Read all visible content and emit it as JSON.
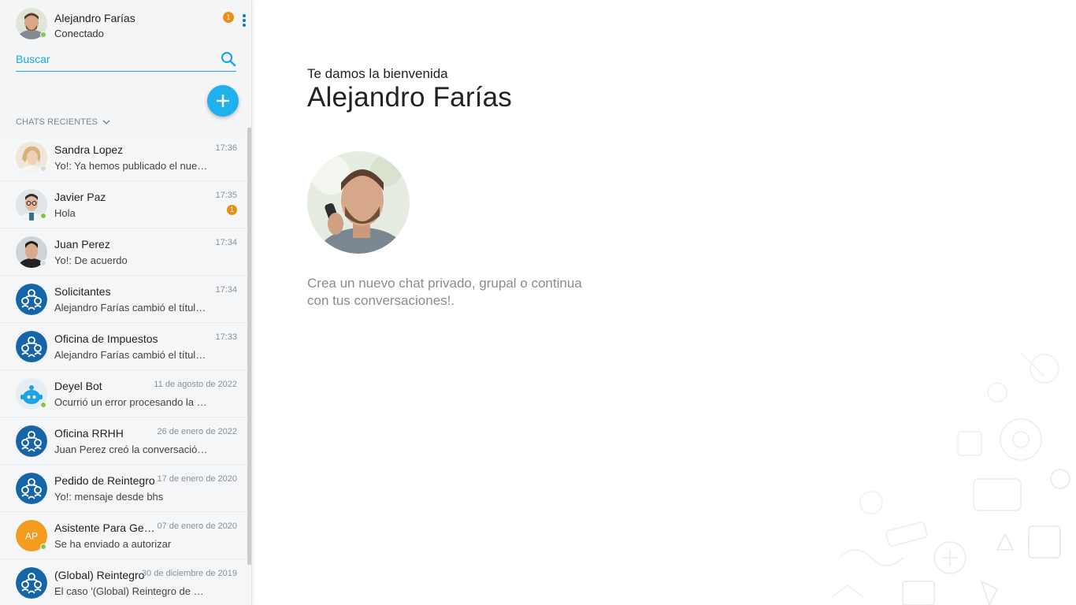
{
  "user": {
    "name": "Alejandro Farías",
    "status": "Conectado",
    "notification_count": "1"
  },
  "search": {
    "placeholder": "Buscar"
  },
  "section": {
    "label": "CHATS RECIENTES"
  },
  "chats": [
    {
      "name": "Sandra Lopez",
      "time": "17:36",
      "preview": "Yo!: Ya hemos publicado el nuevo...",
      "avatar": "photo-woman",
      "presence": "offline",
      "unread": ""
    },
    {
      "name": "Javier Paz",
      "time": "17:35",
      "preview": "Hola",
      "avatar": "photo-man-glasses",
      "presence": "online",
      "unread": "1"
    },
    {
      "name": "Juan Perez",
      "time": "17:34",
      "preview": "Yo!: De acuerdo",
      "avatar": "photo-man-dark",
      "presence": "offline",
      "unread": ""
    },
    {
      "name": "Solicitantes",
      "time": "17:34",
      "preview": "Alejandro Farías cambió el título ...",
      "avatar": "group-icon",
      "presence": "",
      "unread": ""
    },
    {
      "name": "Oficina de Impuestos",
      "time": "17:33",
      "preview": "Alejandro Farías cambió el título ...",
      "avatar": "group-icon",
      "presence": "",
      "unread": ""
    },
    {
      "name": "Deyel Bot",
      "time": "11 de agosto de 2022",
      "preview": "Ocurrió un error procesando la g...",
      "avatar": "bot-icon",
      "presence": "online",
      "unread": ""
    },
    {
      "name": "Oficina RRHH",
      "time": "26 de enero de 2022",
      "preview": "Juan Perez creó la conversación ...",
      "avatar": "group-icon",
      "presence": "",
      "unread": ""
    },
    {
      "name": "Pedido de Reintegro",
      "time": "17 de enero de 2020",
      "preview": "Yo!: mensaje desde bhs",
      "avatar": "group-icon",
      "presence": "",
      "unread": ""
    },
    {
      "name": "Asistente Para Gestión",
      "time": "07 de enero de 2020",
      "preview": "Se ha enviado a autorizar",
      "avatar": "initials",
      "initials": "AP",
      "presence": "online",
      "unread": ""
    },
    {
      "name": "(Global) Reintegro",
      "time": "30 de diciembre de 2019",
      "preview": "El caso '(Global) Reintegro de Ga...",
      "avatar": "group-icon",
      "presence": "",
      "unread": ""
    }
  ],
  "main": {
    "welcome": "Te damos la bienvenida",
    "name": "Alejandro Farías",
    "hint": "Crea un nuevo chat privado, grupal o continua con tus conversaciones!."
  },
  "colors": {
    "accent": "#21a6e0",
    "fab": "#1fb1ec",
    "group": "#1565a8",
    "badge": "#f28c0f",
    "online": "#8bc34a",
    "initials_bg": "#f39c1f"
  }
}
